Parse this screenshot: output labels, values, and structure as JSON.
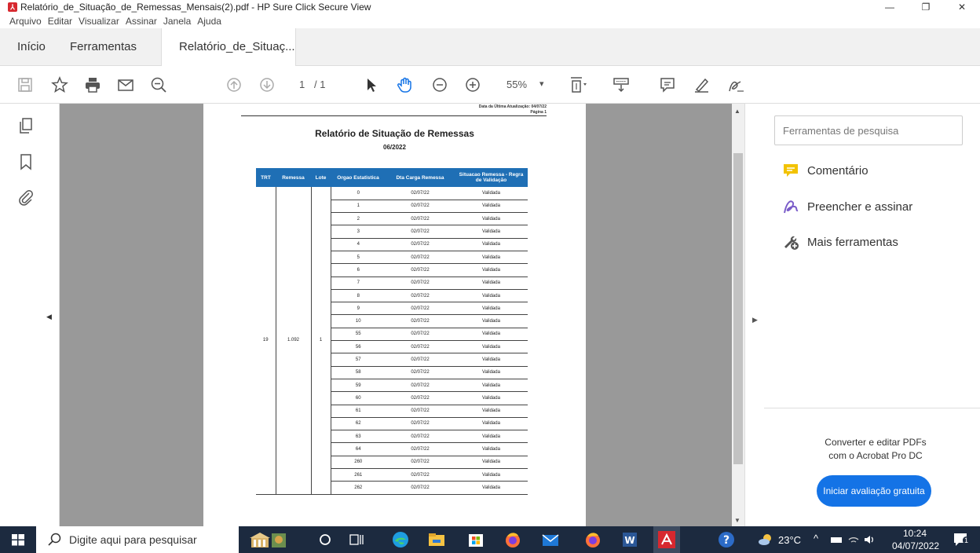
{
  "window": {
    "title": "Relatório_de_Situação_de_Remessas_Mensais(2).pdf - HP Sure Click Secure View",
    "logo_glyph": "⅄",
    "minimize": "—",
    "restore": "❐",
    "close": "✕"
  },
  "menu": [
    "Arquivo",
    "Editar",
    "Visualizar",
    "Assinar",
    "Janela",
    "Ajuda"
  ],
  "tabs": {
    "home": "Início",
    "tools": "Ferramentas",
    "document": "Relatório_de_Situaç...",
    "close": "×"
  },
  "toolbar": {
    "page_current": "1",
    "page_total": "/ 1",
    "zoom": "55%",
    "zoom_caret": "▾"
  },
  "document": {
    "updated": "Data da Última Atualização: 04/07/22",
    "page_label": "Página 1",
    "title": "Relatório de Situação de Remessas",
    "period": "06/2022",
    "headers": [
      "TRT",
      "Remessa",
      "Lote",
      "Orgao Estatistica",
      "Dta Carga Remessa",
      "Situacao Remessa - Regra de Validação"
    ],
    "trt": "19",
    "remessa": "1.092",
    "lote": "1",
    "rows": [
      {
        "orgao": "0",
        "data": "02/07/22",
        "situacao": "Validada"
      },
      {
        "orgao": "1",
        "data": "02/07/22",
        "situacao": "Validada"
      },
      {
        "orgao": "2",
        "data": "02/07/22",
        "situacao": "Validada"
      },
      {
        "orgao": "3",
        "data": "02/07/22",
        "situacao": "Validada"
      },
      {
        "orgao": "4",
        "data": "02/07/22",
        "situacao": "Validada"
      },
      {
        "orgao": "5",
        "data": "02/07/22",
        "situacao": "Validada"
      },
      {
        "orgao": "6",
        "data": "02/07/22",
        "situacao": "Validada"
      },
      {
        "orgao": "7",
        "data": "02/07/22",
        "situacao": "Validada"
      },
      {
        "orgao": "8",
        "data": "02/07/22",
        "situacao": "Validada"
      },
      {
        "orgao": "9",
        "data": "02/07/22",
        "situacao": "Validada"
      },
      {
        "orgao": "10",
        "data": "02/07/22",
        "situacao": "Validada"
      },
      {
        "orgao": "55",
        "data": "02/07/22",
        "situacao": "Validada"
      },
      {
        "orgao": "56",
        "data": "02/07/22",
        "situacao": "Validada"
      },
      {
        "orgao": "57",
        "data": "02/07/22",
        "situacao": "Validada"
      },
      {
        "orgao": "58",
        "data": "02/07/22",
        "situacao": "Validada"
      },
      {
        "orgao": "59",
        "data": "02/07/22",
        "situacao": "Validada"
      },
      {
        "orgao": "60",
        "data": "02/07/22",
        "situacao": "Validada"
      },
      {
        "orgao": "61",
        "data": "02/07/22",
        "situacao": "Validada"
      },
      {
        "orgao": "62",
        "data": "02/07/22",
        "situacao": "Validada"
      },
      {
        "orgao": "63",
        "data": "02/07/22",
        "situacao": "Validada"
      },
      {
        "orgao": "64",
        "data": "02/07/22",
        "situacao": "Validada"
      },
      {
        "orgao": "260",
        "data": "02/07/22",
        "situacao": "Validada"
      },
      {
        "orgao": "261",
        "data": "02/07/22",
        "situacao": "Validada"
      },
      {
        "orgao": "262",
        "data": "02/07/22",
        "situacao": "Validada"
      }
    ]
  },
  "right_panel": {
    "search_placeholder": "Ferramentas de pesquisa",
    "items": [
      {
        "label": "Comentário",
        "icon": "comment-icon"
      },
      {
        "label": "Preencher e assinar",
        "icon": "fill-sign-icon"
      },
      {
        "label": "Mais ferramentas",
        "icon": "more-tools-icon"
      }
    ],
    "promo_line1": "Converter e editar PDFs",
    "promo_line2": "com o Acrobat Pro DC",
    "cta": "Iniciar avaliação gratuita"
  },
  "nav": {
    "left_arrow": "◀",
    "right_arrow": "▶",
    "scroll_up": "▲",
    "scroll_down": "▼"
  },
  "taskbar": {
    "search_text": "Digite aqui para pesquisar",
    "weather": "23°C",
    "time": "10:24",
    "date": "04/07/2022",
    "tray_glyphs": "^",
    "notification_count": "1"
  },
  "colors": {
    "accent": "#1473e6",
    "table_header": "#1f6fb5",
    "taskbar": "#1c2a3f",
    "pdf_red": "#d7282f"
  }
}
